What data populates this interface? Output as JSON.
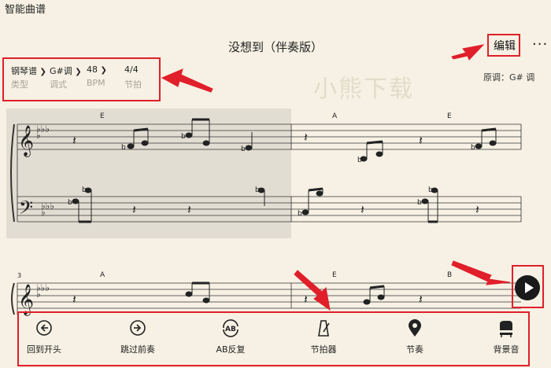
{
  "app": {
    "title": "智能曲谱"
  },
  "song": {
    "title": "没想到（伴奏版）",
    "original_key": "原调：G# 调",
    "watermark": "小熊下载"
  },
  "header": {
    "edit_label": "编辑",
    "more_label": "···"
  },
  "meta": {
    "items": [
      {
        "value": "钢琴谱",
        "label": "类型"
      },
      {
        "value": "G#调",
        "label": "调式"
      },
      {
        "value": "48",
        "label": "BPM"
      },
      {
        "value": "4/4",
        "label": "节拍"
      }
    ]
  },
  "score": {
    "chords_row1": [
      "E",
      "A",
      "E"
    ],
    "chords_row2": [
      "A",
      "E",
      "B"
    ],
    "measure_number_row2": "3"
  },
  "toolbar": {
    "items": [
      {
        "label": "回到开头",
        "icon": "restart-icon"
      },
      {
        "label": "跳过前奏",
        "icon": "skip-intro-icon"
      },
      {
        "label": "AB反复",
        "icon": "ab-repeat-icon"
      },
      {
        "label": "节拍器",
        "icon": "metronome-icon"
      },
      {
        "label": "节奏",
        "icon": "rhythm-icon"
      },
      {
        "label": "背景音",
        "icon": "piano-icon"
      }
    ]
  },
  "colors": {
    "background": "#f6f1e4",
    "highlight": "#e01f2a",
    "selection": "#e2ddd2"
  }
}
